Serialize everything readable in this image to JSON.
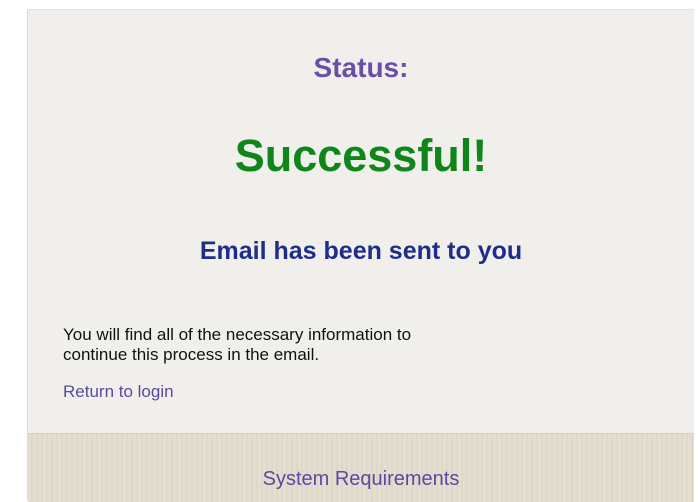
{
  "status": {
    "label": "Status:",
    "value": "Successful!"
  },
  "message": {
    "headline": "Email has been sent to you",
    "body_line1": "You will find all of the necessary information to",
    "body_line2": "continue this process in the email."
  },
  "links": {
    "return_login": "Return to login",
    "system_requirements": "System Requirements"
  },
  "colors": {
    "status_label": "#6a4fa6",
    "success": "#10861a",
    "headline": "#1f2d8a",
    "link": "#5a4a9e",
    "panel_bg": "#f0efec",
    "footer_bg": "#e3ded0"
  }
}
